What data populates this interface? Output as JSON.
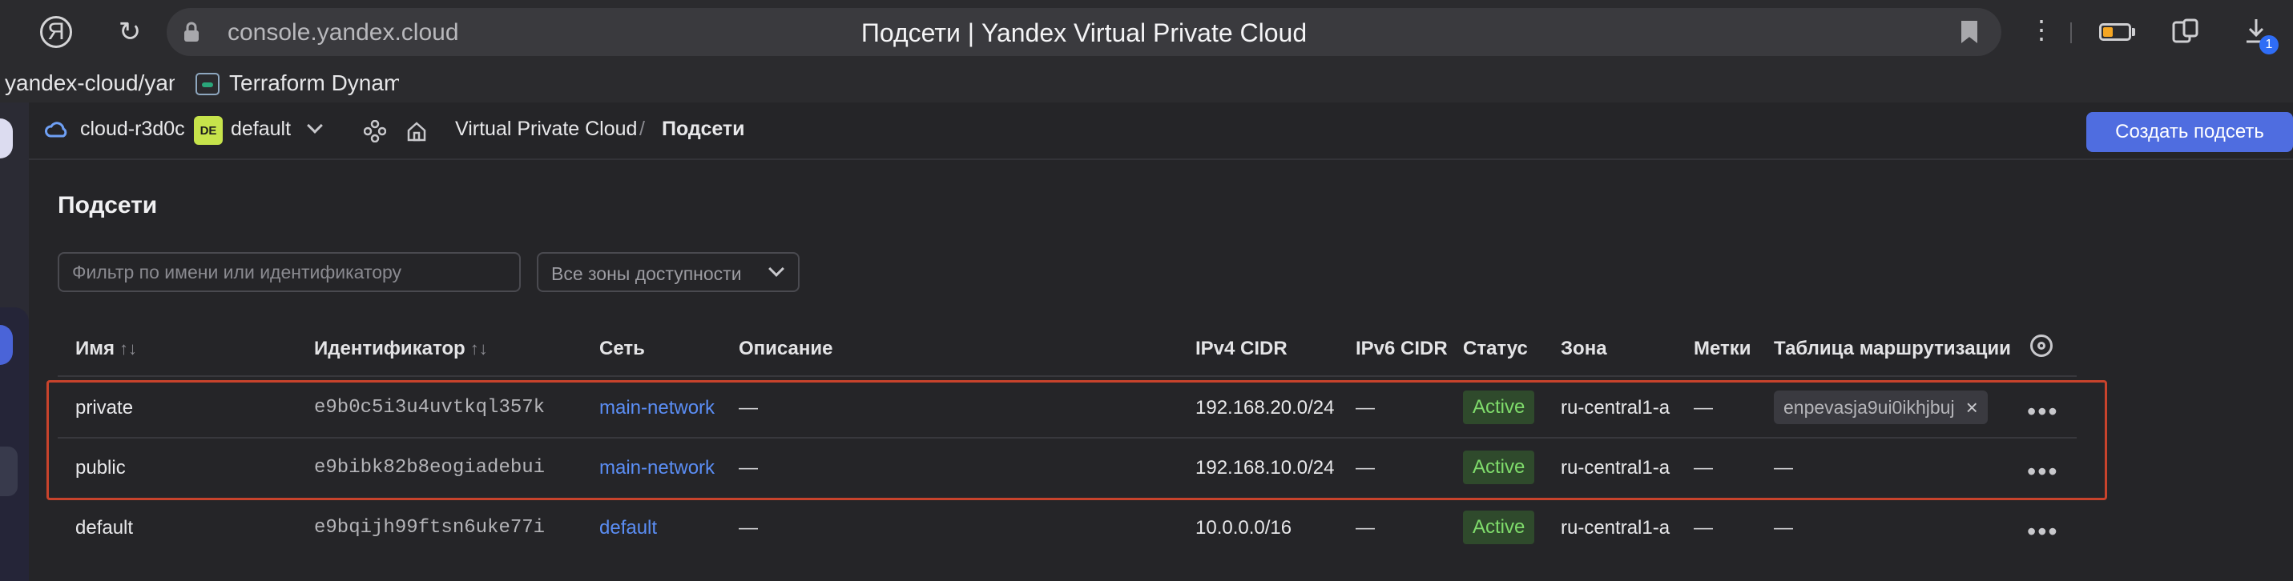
{
  "browser": {
    "url": "console.yandex.cloud",
    "page_title": "Подсети | Yandex Virtual Private Cloud",
    "back_glyph": "Я",
    "reload_glyph": "↻",
    "downloads_count": "1",
    "bookmarks": [
      "yandex-cloud/yanc",
      "Terraform Dynami"
    ]
  },
  "topbar": {
    "cloud": "cloud-r3d0c",
    "folder_badge": "DE",
    "folder": "default",
    "breadcrumb_service": "Virtual Private Cloud",
    "breadcrumb_sep": "/",
    "breadcrumb_page": "Подсети",
    "create_button": "Создать подсеть"
  },
  "page": {
    "heading": "Подсети",
    "filter_placeholder": "Фильтр по имени или идентификатору",
    "zone_select": "Все зоны доступности"
  },
  "table": {
    "columns": {
      "name": "Имя",
      "id": "Идентификатор",
      "network": "Сеть",
      "description": "Описание",
      "ipv4": "IPv4 CIDR",
      "ipv6": "IPv6 CIDR",
      "status": "Статус",
      "zone": "Зона",
      "labels": "Метки",
      "route_table": "Таблица маршрутизации"
    },
    "sort_glyph": "↑↓",
    "rows": [
      {
        "name": "private",
        "id": "e9b0c5i3u4uvtkql357k",
        "network": "main-network",
        "description": "—",
        "ipv4": "192.168.20.0/24",
        "ipv6": "—",
        "status": "Active",
        "zone": "ru-central1-a",
        "labels": "—",
        "route_table": "enpevasja9ui0ikhjbuj",
        "route_table_remove": "×"
      },
      {
        "name": "public",
        "id": "e9bibk82b8eogiadebui",
        "network": "main-network",
        "description": "—",
        "ipv4": "192.168.10.0/24",
        "ipv6": "—",
        "status": "Active",
        "zone": "ru-central1-a",
        "labels": "—",
        "route_table": "—"
      },
      {
        "name": "default",
        "id": "e9bqijh99ftsn6uke77i",
        "network": "default",
        "description": "—",
        "ipv4": "10.0.0.0/16",
        "ipv6": "—",
        "status": "Active",
        "zone": "ru-central1-a",
        "labels": "—",
        "route_table": "—"
      }
    ],
    "row_menu_glyph": "•••"
  },
  "colors": {
    "accent": "#4f6de0",
    "link": "#5b8ef5",
    "status_active_bg": "#2f4a2c",
    "status_active_text": "#7fdc6b",
    "highlight_border": "#c8432c"
  }
}
